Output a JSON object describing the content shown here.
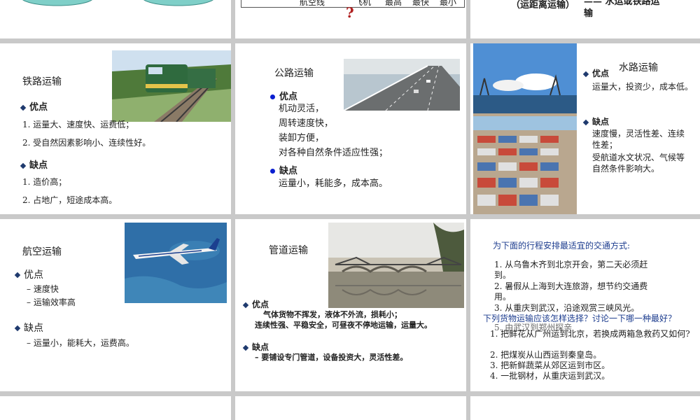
{
  "top": {
    "table_cells": [
      "航空线",
      "飞机",
      "最高",
      "最快",
      "最小"
    ],
    "question_mark": "?",
    "transport_text_1": "（运距离运输）",
    "transport_text_2": "—— 水运或铁路运",
    "transport_text_3": "输"
  },
  "rail": {
    "title": "铁路运输",
    "pros_label": "优点",
    "pros": [
      "1. 运量大、速度快、运费低；",
      "2. 受自然因素影响小、连续性好。"
    ],
    "cons_label": "缺点",
    "cons": [
      "1. 造价高；",
      "2. 占地广，短途成本高。"
    ]
  },
  "road": {
    "title": "公路运输",
    "pros_label": "优点",
    "pros": [
      "机动灵活，",
      "周转速度快，",
      "装卸方便，",
      "对各种自然条件适应性强；"
    ],
    "cons_label": "缺点",
    "cons": [
      "运量小，耗能多，成本高。"
    ]
  },
  "water": {
    "title": "水路运输",
    "pros_label": "优点",
    "pros": [
      "运量大，投资少，成本低。"
    ],
    "cons_label": "缺点",
    "cons": [
      "速度慢，灵活性差、连续",
      "性差；",
      "受航道水文状况、气候等",
      "自然条件影响大。"
    ]
  },
  "air": {
    "title": "航空运输",
    "pros_label": "优点",
    "pros": [
      "– 速度快",
      "– 运输效率高"
    ],
    "cons_label": "缺点",
    "cons": [
      "– 运量小，能耗大，运费高。"
    ]
  },
  "pipe": {
    "title": "管道运输",
    "pros_label": "优点",
    "pros": [
      "气体货物不挥发，液体不外流，损耗小；",
      "连续性强、平稳安全，可昼夜不停地运输，运量大。"
    ],
    "cons_label": "缺点",
    "cons": [
      "– 要铺设专门管道，设备投资大，灵活性差。"
    ]
  },
  "quiz": {
    "heading": "为下面的行程安排最适宜的交通方式:",
    "items": [
      "1. 从乌鲁木齐到北京开会，第二天必须赶",
      "到。",
      "2. 暑假从上海到大连旅游，想节约交通费",
      "用。",
      "3. 从重庆到武汉，沿途观赏三峡风光。",
      "5. 由武汉到郑州探亲"
    ],
    "overlay_heading": "下列货物运输应该怎样选择？讨论一下哪一种最好？",
    "overlay_items": [
      "1. 把鲜花从广州运到北京，若换成两箱急救药又如何?",
      "2. 把煤炭从山西运到秦皇岛。",
      "3. 把新鲜蔬菜从郊区运到市区。",
      "4. 一批钢材，从重庆运到武汉。"
    ]
  }
}
